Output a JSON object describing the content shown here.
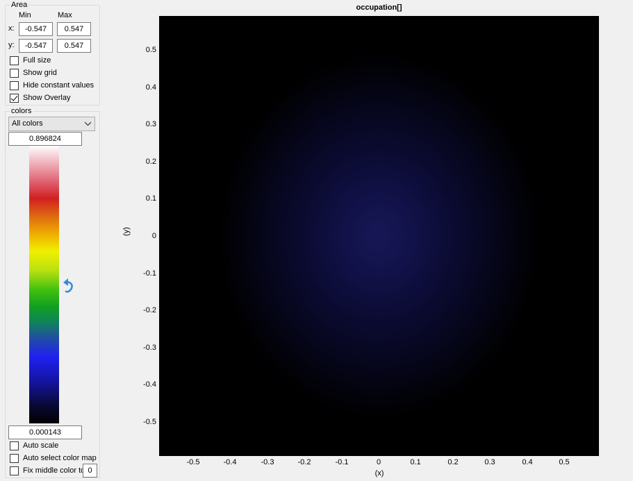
{
  "area": {
    "title": "Area",
    "min_label": "Min",
    "max_label": "Max",
    "x_label": "x:",
    "y_label": "y:",
    "x_min": "-0.547",
    "x_max": "0.547",
    "y_min": "-0.547",
    "y_max": "0.547",
    "options": [
      {
        "label": "Full size",
        "checked": false
      },
      {
        "label": "Show grid",
        "checked": false
      },
      {
        "label": "Hide constant values",
        "checked": false
      },
      {
        "label": "Show Overlay",
        "checked": true
      }
    ]
  },
  "colors": {
    "title": "colors",
    "colormap_selected": "All colors",
    "max_value": "0.896824",
    "min_value": "0.000143",
    "reset_icon": "undo-arrow-icon",
    "options": [
      {
        "label": "Auto scale",
        "checked": false
      },
      {
        "label": "Auto select color map",
        "checked": false
      },
      {
        "label": "Fix middle color to",
        "checked": false
      }
    ],
    "fix_middle_value": "0"
  },
  "plot": {
    "title": "occupation[]",
    "xlabel": "(x)",
    "ylabel": "(y)",
    "xticks": [
      "-0.5",
      "-0.4",
      "-0.3",
      "-0.2",
      "-0.1",
      "0",
      "0.1",
      "0.2",
      "0.3",
      "0.4",
      "0.5"
    ],
    "yticks": [
      "0.5",
      "0.4",
      "0.3",
      "0.2",
      "0.1",
      "0",
      "-0.1",
      "-0.2",
      "-0.3",
      "-0.4",
      "-0.5"
    ]
  },
  "chart_data": {
    "type": "heatmap",
    "title": "occupation[]",
    "xlabel": "(x)",
    "ylabel": "(y)",
    "xlim": [
      -0.59,
      0.59
    ],
    "ylim": [
      -0.59,
      0.59
    ],
    "color_min": 0.000143,
    "color_max": 0.896824,
    "grid": false
  }
}
